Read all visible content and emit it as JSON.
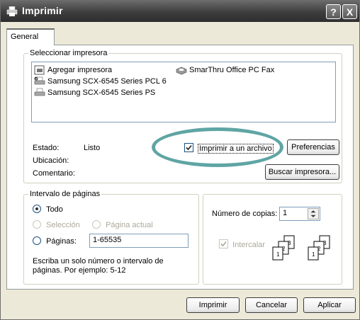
{
  "window": {
    "title": "Imprimir",
    "help_btn": "?",
    "close_btn": "X"
  },
  "tabs": [
    {
      "label": "General"
    }
  ],
  "printer_group": {
    "legend": "Seleccionar impresora",
    "printers": [
      {
        "label": "Agregar impresora",
        "icon": "add-printer-icon"
      },
      {
        "label": "SmarThru Office PC Fax",
        "icon": "fax-printer-icon"
      },
      {
        "label": "Samsung SCX-6545 Series PCL 6",
        "icon": "default-printer-icon",
        "selected": true
      },
      {
        "label": "Samsung SCX-6545 Series PS",
        "icon": "printer-icon"
      }
    ],
    "status_label": "Estado:",
    "status_value": "Listo",
    "location_label": "Ubicación:",
    "comment_label": "Comentario:",
    "print_to_file_label": "Imprimir a un archivo",
    "print_to_file_checked": true,
    "preferences_label": "Preferencias",
    "find_printer_label": "Buscar impresora..."
  },
  "range_group": {
    "legend": "Intervalo de páginas",
    "all_label": "Todo",
    "selection_label": "Selección",
    "current_page_label": "Página actual",
    "pages_label": "Páginas:",
    "pages_value": "1-65535",
    "hint_line1": "Escriba un solo número o intervalo de",
    "hint_line2": "páginas. Por ejemplo: 5-12"
  },
  "copies_group": {
    "copies_label": "Número de copias:",
    "copies_value": "1",
    "collate_label": "Intercalar",
    "collate_checked": true
  },
  "footer": {
    "print_label": "Imprimir",
    "cancel_label": "Cancelar",
    "apply_label": "Aplicar"
  },
  "colors": {
    "highlight": "#5fa5a4",
    "titlebar": "#3d3d3d"
  }
}
